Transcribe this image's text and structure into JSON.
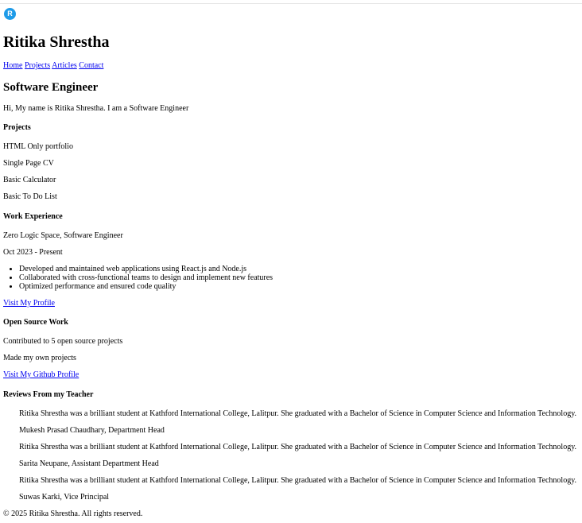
{
  "header": {
    "logo_letter": "R",
    "name": "Ritika Shrestha",
    "nav": [
      "Home",
      "Projects",
      "Articles",
      "Contact"
    ]
  },
  "intro": {
    "title": "Software Engineer",
    "text": "Hi, My name is Ritika Shrestha. I am a Software Engineer"
  },
  "projects": {
    "heading": "Projects",
    "items": [
      "HTML Only portfolio",
      "Single Page CV",
      "Basic Calculator",
      "Basic To Do List"
    ]
  },
  "work": {
    "heading": "Work Experience",
    "company": "Zero Logic Space, Software Engineer",
    "period": "Oct 2023 - Present",
    "bullets": [
      "Developed and maintained web applications using React.js and Node.js",
      "Collaborated with cross-functional teams to design and implement new features",
      "Optimized performance and ensured code quality"
    ],
    "profile_link": "Visit My Profile"
  },
  "opensource": {
    "heading": "Open Source Work",
    "line1": "Contributed to 5 open source projects",
    "line2": "Made my own projects",
    "github_link": "Visit My Github Profile"
  },
  "reviews": {
    "heading": "Reviews From my Teacher",
    "items": [
      {
        "quote": "Ritika Shrestha was a brilliant student at Kathford International College, Lalitpur. She graduated with a Bachelor of Science in Computer Science and Information Technology.",
        "author": "Mukesh Prasad Chaudhary, Department Head"
      },
      {
        "quote": "Ritika Shrestha was a brilliant student at Kathford International College, Lalitpur. She graduated with a Bachelor of Science in Computer Science and Information Technology.",
        "author": "Sarita Neupane, Assistant Department Head"
      },
      {
        "quote": "Ritika Shrestha was a brilliant student at Kathford International College, Lalitpur. She graduated with a Bachelor of Science in Computer Science and Information Technology.",
        "author": "Suwas Karki, Vice Principal"
      }
    ]
  },
  "footer": {
    "text": "© 2025 Ritika Shrestha. All rights reserved."
  }
}
